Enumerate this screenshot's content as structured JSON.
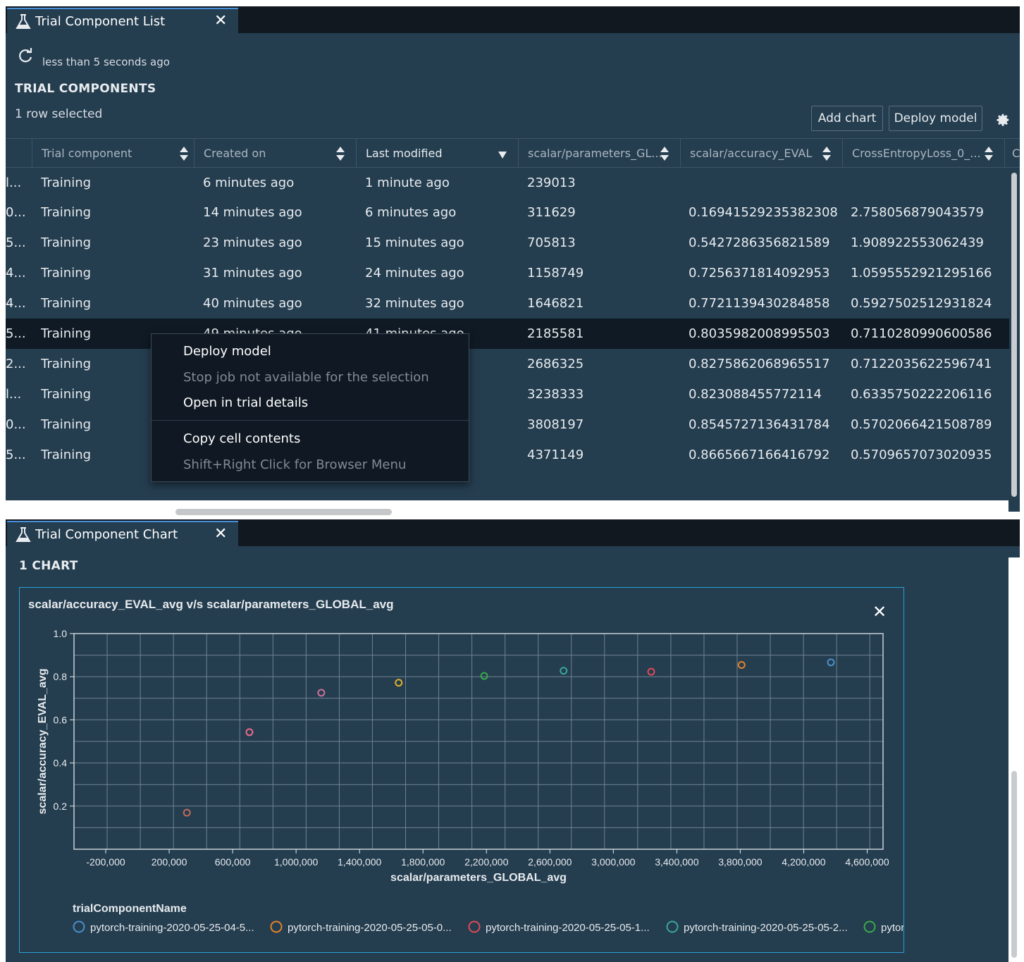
{
  "list_panel": {
    "tab_title": "Trial Component List",
    "refresh_text": "less than 5 seconds ago",
    "section_title": "TRIAL COMPONENTS",
    "selection_text": "1 row selected",
    "add_chart": "Add chart",
    "deploy_model": "Deploy model",
    "columns": [
      "",
      "Trial component",
      "Created on",
      "Last modified",
      "scalar/parameters_GL...",
      "scalar/accuracy_EVAL",
      "CrossEntropyLoss_0_...",
      "C"
    ],
    "rows": [
      {
        "id": "l...",
        "component": "Training",
        "created": "6 minutes ago",
        "modified": "1 minute ago",
        "params": "239013",
        "accuracy": "",
        "loss": ""
      },
      {
        "id": "0...",
        "component": "Training",
        "created": "14 minutes ago",
        "modified": "6 minutes ago",
        "params": "311629",
        "accuracy": "0.16941529235382308",
        "loss": "2.758056879043579"
      },
      {
        "id": "5...",
        "component": "Training",
        "created": "23 minutes ago",
        "modified": "15 minutes ago",
        "params": "705813",
        "accuracy": "0.5427286356821589",
        "loss": "1.908922553062439"
      },
      {
        "id": "4...",
        "component": "Training",
        "created": "31 minutes ago",
        "modified": "24 minutes ago",
        "params": "1158749",
        "accuracy": "0.7256371814092953",
        "loss": "1.0595552921295166"
      },
      {
        "id": "4...",
        "component": "Training",
        "created": "40 minutes ago",
        "modified": "32 minutes ago",
        "params": "1646821",
        "accuracy": "0.7721139430284858",
        "loss": "0.5927502512931824"
      },
      {
        "id": "5...",
        "component": "Training",
        "created": "49 minutes ago",
        "modified": "41 minutes ago",
        "params": "2185581",
        "accuracy": "0.8035982008995503",
        "loss": "0.7110280990600586"
      },
      {
        "id": "2...",
        "component": "Training",
        "created": "",
        "modified": "",
        "params": "2686325",
        "accuracy": "0.8275862068965517",
        "loss": "0.7122035622596741"
      },
      {
        "id": "l...",
        "component": "Training",
        "created": "",
        "modified": "",
        "params": "3238333",
        "accuracy": "0.823088455772114",
        "loss": "0.6335750222206116"
      },
      {
        "id": "0...",
        "component": "Training",
        "created": "",
        "modified": "",
        "params": "3808197",
        "accuracy": "0.8545727136431784",
        "loss": "0.5702066421508789"
      },
      {
        "id": "5...",
        "component": "Training",
        "created": "",
        "modified": "",
        "params": "4371149",
        "accuracy": "0.8665667166416792",
        "loss": "0.5709657073020935"
      }
    ],
    "context_menu": [
      {
        "label": "Deploy model",
        "enabled": true
      },
      {
        "label": "Stop job not available for the selection",
        "enabled": false
      },
      {
        "label": "Open in trial details",
        "enabled": true
      },
      {
        "label": "Copy cell contents",
        "enabled": true
      },
      {
        "label": "Shift+Right Click for Browser Menu",
        "enabled": false
      }
    ]
  },
  "chart_panel": {
    "tab_title": "Trial Component Chart",
    "section_title": "1 CHART",
    "chart_title": "scalar/accuracy_EVAL_avg v/s scalar/parameters_GLOBAL_avg",
    "legend_title": "trialComponentName",
    "legend": [
      {
        "name": "pytorch-training-2020-05-25-04-5...",
        "color": "#4c8fc9"
      },
      {
        "name": "pytorch-training-2020-05-25-05-0...",
        "color": "#e2832a"
      },
      {
        "name": "pytorch-training-2020-05-25-05-1...",
        "color": "#e04a57"
      },
      {
        "name": "pytorch-training-2020-05-25-05-2...",
        "color": "#3aa69a"
      },
      {
        "name": "pytor",
        "color": "#3aaa4a"
      }
    ]
  },
  "chart_data": {
    "type": "scatter",
    "title": "scalar/accuracy_EVAL_avg v/s scalar/parameters_GLOBAL_avg",
    "xlabel": "scalar/parameters_GLOBAL_avg",
    "ylabel": "scalar/accuracy_EVAL_avg",
    "xlim": [
      -400000,
      4700000
    ],
    "ylim": [
      0.0,
      1.0
    ],
    "xticks": [
      -200000,
      200000,
      600000,
      1000000,
      1400000,
      1800000,
      2200000,
      2600000,
      3000000,
      3400000,
      3800000,
      4200000,
      4600000
    ],
    "xtick_labels": [
      "-200,000",
      "200,000",
      "600,000",
      "1,000,000",
      "1,400,000",
      "1,800,000",
      "2,200,000",
      "2,600,000",
      "3,000,000",
      "3,400,000",
      "3,800,000",
      "4,200,000",
      "4,600,000"
    ],
    "yticks": [
      0.2,
      0.4,
      0.6,
      0.8,
      1.0
    ],
    "ytick_labels": [
      "0.2",
      "0.4",
      "0.6",
      "0.8",
      "1.0"
    ],
    "grid": true,
    "legend_position": "bottom",
    "points": [
      {
        "x": 311629,
        "y": 0.16941529235382308,
        "color": "#c06a5a"
      },
      {
        "x": 705813,
        "y": 0.5427286356821589,
        "color": "#e86a8a"
      },
      {
        "x": 1158749,
        "y": 0.7256371814092953,
        "color": "#d0709a"
      },
      {
        "x": 1646821,
        "y": 0.7721139430284858,
        "color": "#e3b12c"
      },
      {
        "x": 2185581,
        "y": 0.8035982008995503,
        "color": "#3aaa4a"
      },
      {
        "x": 2686325,
        "y": 0.8275862068965517,
        "color": "#3aa69a"
      },
      {
        "x": 3238333,
        "y": 0.823088455772114,
        "color": "#e04a57"
      },
      {
        "x": 3808197,
        "y": 0.8545727136431784,
        "color": "#e2832a"
      },
      {
        "x": 4371149,
        "y": 0.8665667166416792,
        "color": "#4c8fc9"
      }
    ]
  }
}
